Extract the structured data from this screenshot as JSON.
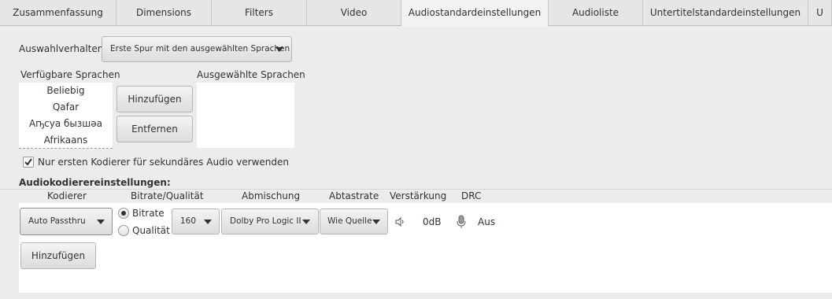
{
  "tabs": [
    {
      "label": "Zusammenfassung",
      "active": false
    },
    {
      "label": "Dimensions",
      "active": false
    },
    {
      "label": "Filters",
      "active": false
    },
    {
      "label": "Video",
      "active": false
    },
    {
      "label": "Audiostandardeinstellungen",
      "active": true
    },
    {
      "label": "Audioliste",
      "active": false
    },
    {
      "label": "Untertitelstandardeinstellungen",
      "active": false
    },
    {
      "label": "U",
      "active": false
    }
  ],
  "selection": {
    "label": "Auswahlverhalten:",
    "value": "Erste Spur mit den ausgewählten Sprachen"
  },
  "languages": {
    "available_label": "Verfügbare Sprachen",
    "selected_label": "Ausgewählte Sprachen",
    "available": [
      "Beliebig",
      "Qafar",
      "Аҧсуа бызшәа",
      "Afrikaans"
    ],
    "add_label": "Hinzufügen",
    "remove_label": "Entfernen"
  },
  "first_encoder": {
    "checked": true,
    "label": "Nur ersten Kodierer für sekundäres Audio verwenden"
  },
  "encoder_settings": {
    "title": "Audiokodierereinstellungen:",
    "headers": {
      "encoder": "Kodierer",
      "bitrate_quality": "Bitrate/Qualität",
      "mixdown": "Abmischung",
      "samplerate": "Abtastrate",
      "gain": "Verstärkung",
      "drc": "DRC"
    },
    "row": {
      "encoder": "Auto Passthru",
      "bitrate_option": "Bitrate",
      "quality_option": "Qualität",
      "bitrate_selected": true,
      "bitrate_value": "160",
      "mixdown": "Dolby Pro Logic II",
      "samplerate": "Wie Quelle",
      "gain": "0dB",
      "drc": "Aus"
    },
    "add_label": "Hinzufügen"
  },
  "icons": {
    "gain": "speaker-icon",
    "drc": "microphone-icon",
    "dropdown": "chevron-down-icon"
  }
}
